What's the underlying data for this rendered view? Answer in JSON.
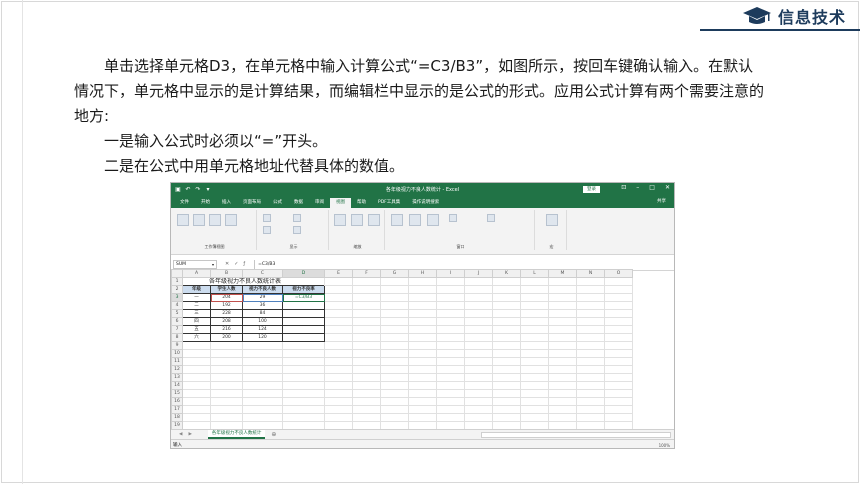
{
  "brand": {
    "title": "信息技术"
  },
  "paragraphs": [
    "单击选择单元格D3，在单元格中输入计算公式“=C3/B3”，如图所示，按回车键确认输入。在默认情况下，单元格中显示的是计算结果，而编辑栏中显示的是公式的形式。应用公式计算有两个需要注意的地方:",
    "一是输入公式时必须以“=”开头。",
    "二是在公式中用单元格地址代替具体的数值。"
  ],
  "excel": {
    "title": "各年级视力不良人数统计 - Excel",
    "login": "登录",
    "tabs": [
      "文件",
      "开始",
      "插入",
      "页面布局",
      "公式",
      "数据",
      "审阅",
      "视图",
      "帮助",
      "PDF工具集",
      "操作说明搜索"
    ],
    "active_tab": "视图",
    "share": "共享",
    "ribbon_groups": [
      "工作簿视图",
      "显示",
      "缩放",
      "窗口",
      "宏"
    ],
    "namebox": "SUM",
    "formula": "=C3/B3",
    "columns": [
      "A",
      "B",
      "C",
      "D",
      "E",
      "F",
      "G",
      "H",
      "I",
      "J",
      "K",
      "L",
      "M",
      "N",
      "O"
    ],
    "sheet_title": "各年级视力不良人数统计表",
    "headers": [
      "年级",
      "学生人数",
      "视力不良人数",
      "视力不良率"
    ],
    "rows": [
      [
        "一",
        "204",
        "29",
        "=C3/B3"
      ],
      [
        "二",
        "192",
        "36",
        ""
      ],
      [
        "三",
        "228",
        "84",
        ""
      ],
      [
        "四",
        "208",
        "100",
        ""
      ],
      [
        "五",
        "216",
        "124",
        ""
      ],
      [
        "六",
        "200",
        "120",
        ""
      ]
    ],
    "sheet_tab": "各年级视力不良人数统计",
    "status": "输入",
    "zoom": "100%"
  }
}
